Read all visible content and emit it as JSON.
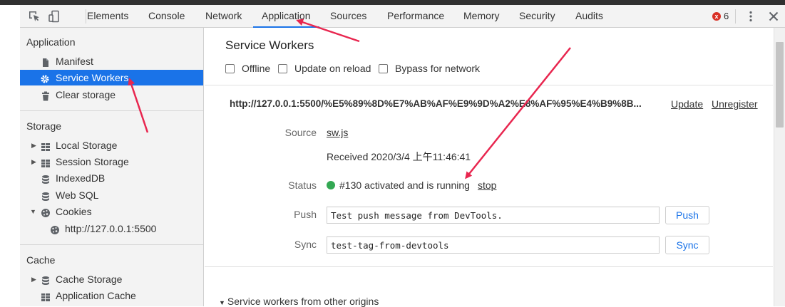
{
  "toolbar": {
    "tabs": [
      {
        "label": "Elements"
      },
      {
        "label": "Console"
      },
      {
        "label": "Network"
      },
      {
        "label": "Application"
      },
      {
        "label": "Sources"
      },
      {
        "label": "Performance"
      },
      {
        "label": "Memory"
      },
      {
        "label": "Security"
      },
      {
        "label": "Audits"
      }
    ],
    "active_tab": "Application",
    "error_count": "6",
    "error_icon": "x",
    "icons": [
      "inspect-icon",
      "device-toolbar-icon",
      "more-vert-icon",
      "close-icon"
    ]
  },
  "sidebar": {
    "application_title": "Application",
    "application_items": [
      {
        "label": "Manifest",
        "icon": "file-icon"
      },
      {
        "label": "Service Workers",
        "icon": "gear-icon"
      },
      {
        "label": "Clear storage",
        "icon": "trash-icon"
      }
    ],
    "storage_title": "Storage",
    "storage_items": [
      {
        "label": "Local Storage",
        "icon": "grid-icon"
      },
      {
        "label": "Session Storage",
        "icon": "grid-icon"
      },
      {
        "label": "IndexedDB",
        "icon": "database-icon"
      },
      {
        "label": "Web SQL",
        "icon": "database-icon"
      },
      {
        "label": "Cookies",
        "icon": "cookie-icon"
      },
      {
        "label": "http://127.0.0.1:5500",
        "icon": "cookie-icon"
      }
    ],
    "cache_title": "Cache",
    "cache_items": [
      {
        "label": "Cache Storage",
        "icon": "database-icon"
      },
      {
        "label": "Application Cache",
        "icon": "grid-icon"
      }
    ],
    "selected": "Service Workers"
  },
  "main": {
    "title": "Service Workers",
    "checkboxes": [
      {
        "label": "Offline",
        "checked": false
      },
      {
        "label": "Update on reload",
        "checked": false
      },
      {
        "label": "Bypass for network",
        "checked": false
      }
    ],
    "worker": {
      "url": "http://127.0.0.1:5500/%E5%89%8D%E7%AB%AF%E9%9D%A2%E8%AF%95%E4%B9%8B...",
      "update_link": "Update",
      "unregister_link": "Unregister",
      "source_label": "Source",
      "source_value": "sw.js",
      "received": "Received 2020/3/4 上午11:46:41",
      "status_label": "Status",
      "status_text": "#130 activated and is running",
      "status_color": "#33a853",
      "stop_link": "stop",
      "push_label": "Push",
      "push_value": "Test push message from DevTools.",
      "push_button": "Push",
      "sync_label": "Sync",
      "sync_value": "test-tag-from-devtools",
      "sync_button": "Sync"
    },
    "other_origins": "Service workers from other origins"
  },
  "colors": {
    "accent": "#1a73e8",
    "link": "#1155cc",
    "annotation_arrow": "#e8264f"
  }
}
